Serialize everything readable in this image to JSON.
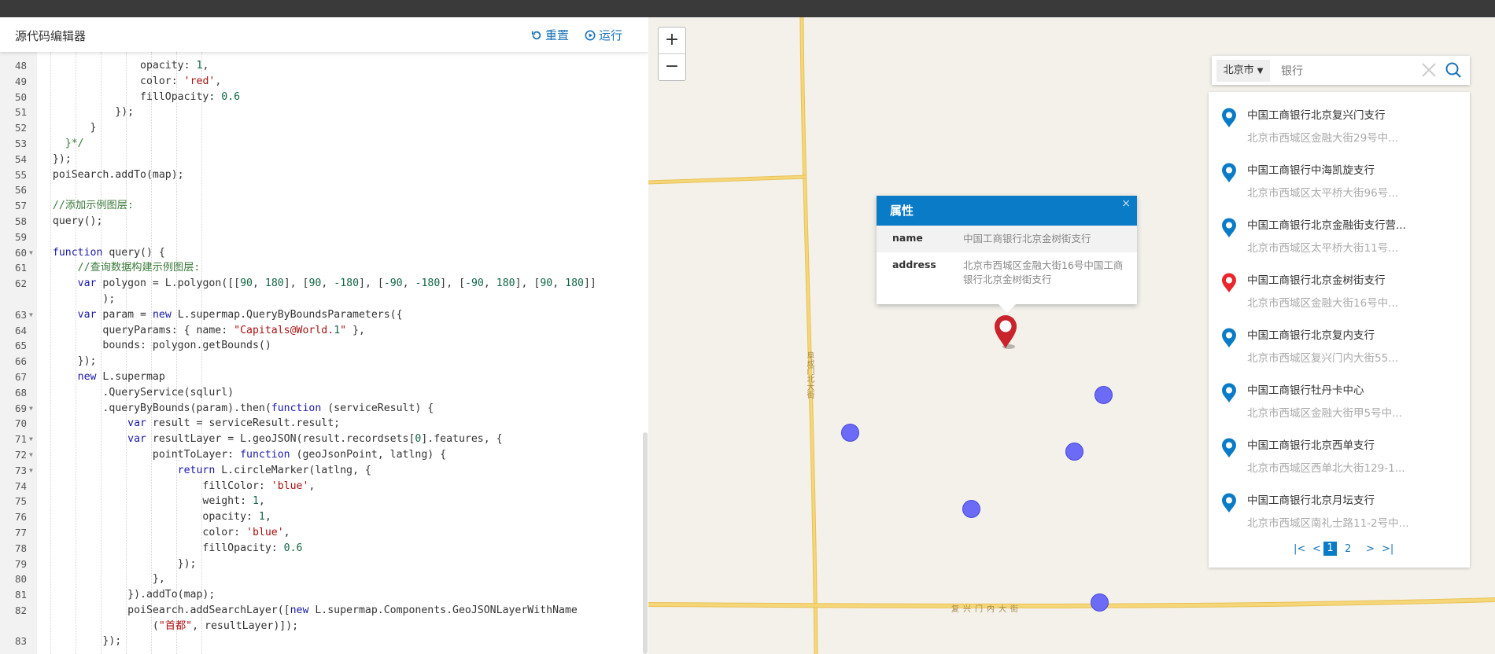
{
  "editor": {
    "title": "源代码编辑器",
    "reset_label": "重置",
    "run_label": "运行"
  },
  "code_lines": [
    {
      "n": "48",
      "text": "                opacity: 1,"
    },
    {
      "n": "49",
      "text": "                color: 'red',"
    },
    {
      "n": "50",
      "text": "                fillOpacity: 0.6"
    },
    {
      "n": "51",
      "text": "            });"
    },
    {
      "n": "52",
      "text": "        }"
    },
    {
      "n": "53",
      "text": "    }*/"
    },
    {
      "n": "54",
      "text": "  });"
    },
    {
      "n": "55",
      "text": "  poiSearch.addTo(map);"
    },
    {
      "n": "56",
      "text": ""
    },
    {
      "n": "57",
      "text": "  //添加示例图层:"
    },
    {
      "n": "58",
      "text": "  query();"
    },
    {
      "n": "59",
      "text": ""
    },
    {
      "n": "60",
      "text": "  function query() {"
    },
    {
      "n": "61",
      "text": "      //查询数据构建示例图层:"
    },
    {
      "n": "62",
      "text": "      var polygon = L.polygon([[90, 180], [90, -180], [-90, -180], [-90, 180], [90, 180]]\n          );"
    },
    {
      "n": "63",
      "text": "      var param = new L.supermap.QueryByBoundsParameters({"
    },
    {
      "n": "64",
      "text": "          queryParams: { name: \"Capitals@World.1\" },"
    },
    {
      "n": "65",
      "text": "          bounds: polygon.getBounds()"
    },
    {
      "n": "66",
      "text": "      });"
    },
    {
      "n": "67",
      "text": "      new L.supermap"
    },
    {
      "n": "68",
      "text": "          .QueryService(sqlurl)"
    },
    {
      "n": "69",
      "text": "          .queryByBounds(param).then(function (serviceResult) {"
    },
    {
      "n": "70",
      "text": "              var result = serviceResult.result;"
    },
    {
      "n": "71",
      "text": "              var resultLayer = L.geoJSON(result.recordsets[0].features, {"
    },
    {
      "n": "72",
      "text": "                  pointToLayer: function (geoJsonPoint, latlng) {"
    },
    {
      "n": "73",
      "text": "                      return L.circleMarker(latlng, {"
    },
    {
      "n": "74",
      "text": "                          fillColor: 'blue',"
    },
    {
      "n": "75",
      "text": "                          weight: 1,"
    },
    {
      "n": "76",
      "text": "                          opacity: 1,"
    },
    {
      "n": "77",
      "text": "                          color: 'blue',"
    },
    {
      "n": "78",
      "text": "                          fillOpacity: 0.6"
    },
    {
      "n": "79",
      "text": "                      });"
    },
    {
      "n": "80",
      "text": "                  },"
    },
    {
      "n": "81",
      "text": "              }).addTo(map);"
    },
    {
      "n": "82",
      "text": "              poiSearch.addSearchLayer([new L.supermap.Components.GeoJSONLayerWithName\n                  (\"首都\", resultLayer)]);"
    },
    {
      "n": "83",
      "text": "          });"
    }
  ],
  "map": {
    "zoom_in": "+",
    "zoom_out": "−",
    "road_vertical_label": "阜成门北大街",
    "road_horizontal_label": "复兴门内大街"
  },
  "popup": {
    "title": "属性",
    "close": "×",
    "name_key": "name",
    "name_value": "中国工商银行北京金树街支行",
    "address_key": "address",
    "address_value": "北京市西城区金融大街16号中国工商银行北京金树街支行"
  },
  "search": {
    "city": "北京市",
    "placeholder": "银行"
  },
  "results": [
    {
      "name": "中国工商银行北京复兴门支行",
      "address": "北京市西城区金融大街29号中...",
      "selected": false
    },
    {
      "name": "中国工商银行中海凯旋支行",
      "address": "北京市西城区太平桥大街96号...",
      "selected": false
    },
    {
      "name": "中国工商银行北京金融街支行营...",
      "address": "北京市西城区太平桥大街11号...",
      "selected": false
    },
    {
      "name": "中国工商银行北京金树街支行",
      "address": "北京市西城区金融大街16号中...",
      "selected": true
    },
    {
      "name": "中国工商银行北京复内支行",
      "address": "北京市西城区复兴门内大街55...",
      "selected": false
    },
    {
      "name": "中国工商银行牡丹卡中心",
      "address": "北京市西城区金融大街甲5号中...",
      "selected": false
    },
    {
      "name": "中国工商银行北京西单支行",
      "address": "北京市西城区西单北大街129-1...",
      "selected": false
    },
    {
      "name": "中国工商银行北京月坛支行",
      "address": "北京市西城区南礼士路11-2号中...",
      "selected": false
    }
  ],
  "pager": {
    "first": "|<",
    "prev": "<",
    "page1": "1",
    "page2": "2",
    "next": ">",
    "last": ">|",
    "current": "1"
  },
  "colors": {
    "accent": "#0a7bc7",
    "marker_blue": "#0a7bc7",
    "marker_red": "#e8262b",
    "circle_fill": "#6b6bf6"
  }
}
